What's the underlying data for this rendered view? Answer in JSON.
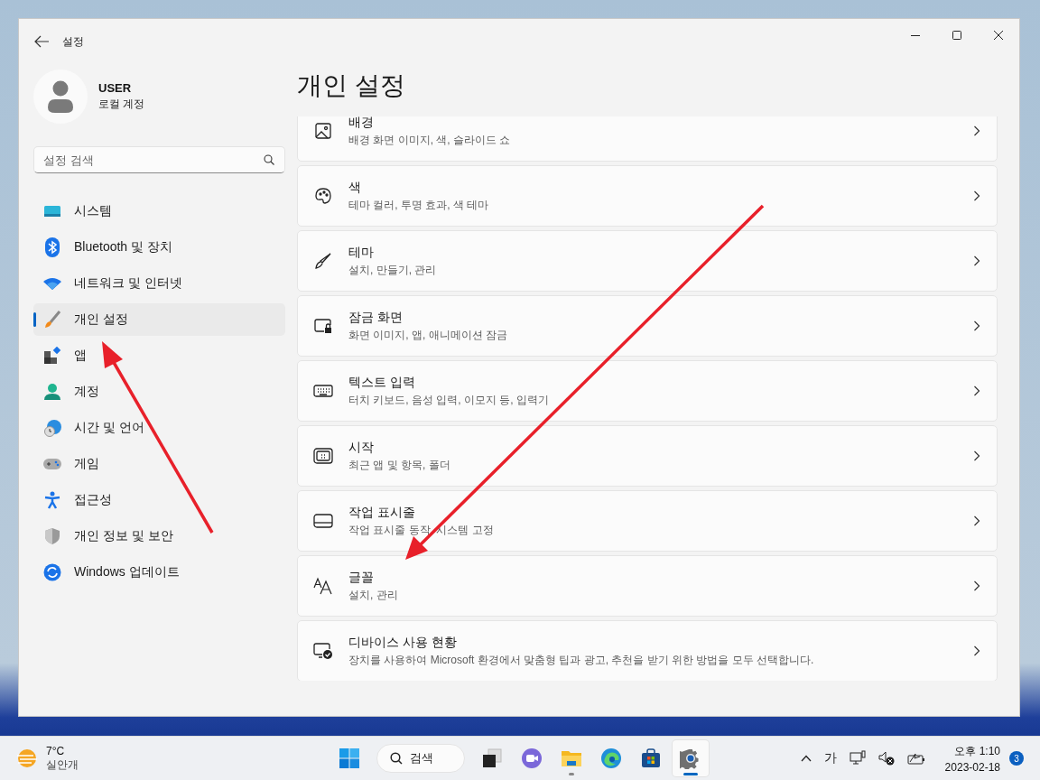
{
  "window": {
    "title": "설정"
  },
  "user": {
    "name": "USER",
    "account": "로컬 계정"
  },
  "search": {
    "placeholder": "설정 검색"
  },
  "sidebar": {
    "items": [
      {
        "kind": "system",
        "label": "시스템",
        "selected": false
      },
      {
        "kind": "bluetooth",
        "label": "Bluetooth 및 장치",
        "selected": false
      },
      {
        "kind": "network",
        "label": "네트워크 및 인터넷",
        "selected": false
      },
      {
        "kind": "personalization",
        "label": "개인 설정",
        "selected": true
      },
      {
        "kind": "apps",
        "label": "앱",
        "selected": false
      },
      {
        "kind": "accounts",
        "label": "계정",
        "selected": false
      },
      {
        "kind": "time",
        "label": "시간 및 언어",
        "selected": false
      },
      {
        "kind": "gaming",
        "label": "게임",
        "selected": false
      },
      {
        "kind": "accessibility",
        "label": "접근성",
        "selected": false
      },
      {
        "kind": "privacy",
        "label": "개인 정보 및 보안",
        "selected": false
      },
      {
        "kind": "update",
        "label": "Windows 업데이트",
        "selected": false
      }
    ]
  },
  "page": {
    "title": "개인 설정",
    "cards": [
      {
        "kind": "background",
        "title": "배경",
        "subtitle": "배경 화면 이미지, 색, 슬라이드 쇼"
      },
      {
        "kind": "colors",
        "title": "색",
        "subtitle": "테마 컬러, 투명 효과, 색 테마"
      },
      {
        "kind": "themes",
        "title": "테마",
        "subtitle": "설치, 만들기, 관리"
      },
      {
        "kind": "lockscreen",
        "title": "잠금 화면",
        "subtitle": "화면 이미지, 앱, 애니메이션 잠금"
      },
      {
        "kind": "textinput",
        "title": "텍스트 입력",
        "subtitle": "터치 키보드, 음성 입력, 이모지 등, 입력기"
      },
      {
        "kind": "start",
        "title": "시작",
        "subtitle": "최근 앱 및 항목, 폴더"
      },
      {
        "kind": "taskbar",
        "title": "작업 표시줄",
        "subtitle": "작업 표시줄 동작, 시스템 고정"
      },
      {
        "kind": "fonts",
        "title": "글꼴",
        "subtitle": "설치, 관리"
      },
      {
        "kind": "device",
        "title": "디바이스 사용 현황",
        "subtitle": "장치를 사용하여 Microsoft 환경에서 맞춤형 팁과 광고, 추천을 받기 위한 방법을 모두 선택합니다."
      }
    ]
  },
  "taskbar": {
    "weather": {
      "temperature": "7°C",
      "condition": "실안개"
    },
    "search_label": "검색",
    "apps": [
      {
        "kind": "taskview",
        "running": false,
        "selected": false
      },
      {
        "kind": "chat",
        "running": false,
        "selected": false
      },
      {
        "kind": "files",
        "running": true,
        "selected": false
      },
      {
        "kind": "edge",
        "running": false,
        "selected": false
      },
      {
        "kind": "store",
        "running": false,
        "selected": false
      },
      {
        "kind": "settings",
        "running": true,
        "selected": true
      }
    ],
    "input_method": "가",
    "time": "오후 1:10",
    "date": "2023-02-18",
    "notifications": "3"
  }
}
